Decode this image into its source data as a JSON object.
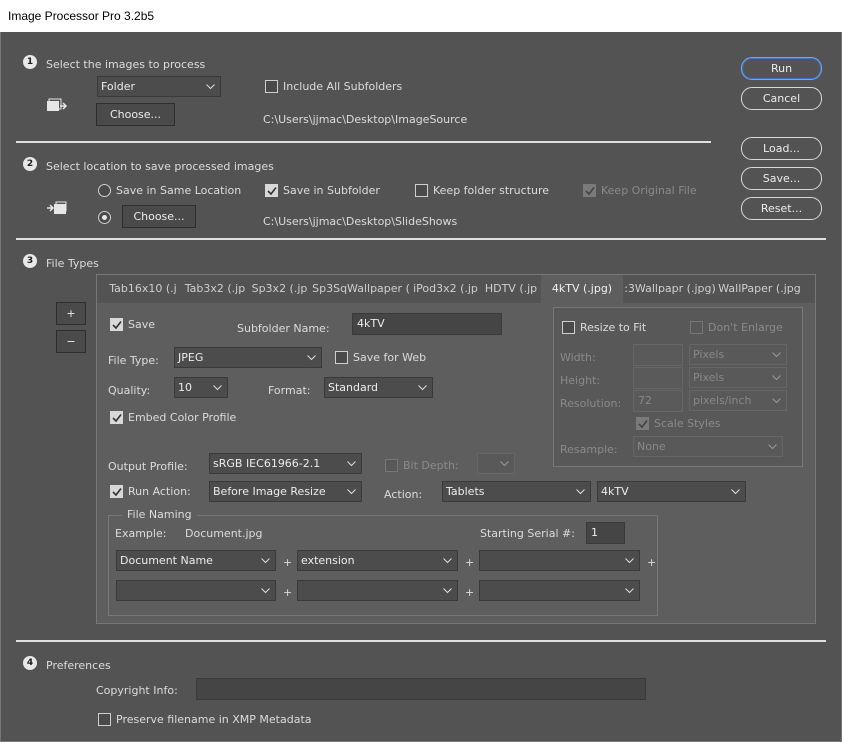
{
  "window": {
    "title": "Image Processor Pro 3.2b5"
  },
  "section1": {
    "num": "1",
    "heading": "Select the images to process",
    "source_type": "Folder",
    "include_subfolders": "Include All Subfolders",
    "choose_label": "Choose...",
    "path": "C:\\Users\\jjmac\\Desktop\\ImageSource"
  },
  "section2": {
    "num": "2",
    "heading": "Select location to save processed images",
    "same_location": "Save in Same Location",
    "save_subfolder": "Save in Subfolder",
    "keep_structure": "Keep folder structure",
    "keep_original": "Keep Original File",
    "choose_label": "Choose...",
    "path": "C:\\Users\\jjmac\\Desktop\\SlideShows"
  },
  "buttons": {
    "run": "Run",
    "cancel": "Cancel",
    "load": "Load...",
    "save": "Save...",
    "reset": "Reset..."
  },
  "section3": {
    "num": "3",
    "heading": "File Types",
    "plus": "+",
    "minus": "−",
    "tabs": [
      "Tab16x10 (.j",
      "Tab3x2 (.jp",
      "Sp3x2 (.jp",
      "Sp3SqWallpaper (",
      "iPod3x2 (.jp",
      "HDTV (.jp",
      "4kTV (.jpg)",
      ":3Wallpapr (.jpg)",
      "WallPaper (.jpg"
    ],
    "save": "Save",
    "subfolder_name_label": "Subfolder Name:",
    "subfolder_name": "4kTV",
    "file_type_label": "File Type:",
    "file_type": "JPEG",
    "save_for_web": "Save for Web",
    "quality_label": "Quality:",
    "quality": "10",
    "format_label": "Format:",
    "format": "Standard",
    "embed_profile": "Embed Color Profile",
    "output_profile_label": "Output Profile:",
    "output_profile": "sRGB IEC61966-2.1",
    "bit_depth": "Bit Depth:",
    "run_action": "Run Action:",
    "run_action_when": "Before Image Resize",
    "action_label": "Action:",
    "action_set": "Tablets",
    "action_name": "4kTV",
    "resize": {
      "resize_to_fit": "Resize to Fit",
      "dont_enlarge": "Don't Enlarge",
      "width_label": "Width:",
      "height_label": "Height:",
      "resolution_label": "Resolution:",
      "resolution": "72",
      "width_unit": "Pixels",
      "height_unit": "Pixels",
      "res_unit": "pixels/inch",
      "scale_styles": "Scale Styles",
      "resample_label": "Resample:",
      "resample": "None"
    },
    "naming": {
      "legend": "File Naming",
      "example_label": "Example:",
      "example": "Document.jpg",
      "serial_label": "Starting Serial #:",
      "serial": "1",
      "field1": "Document Name",
      "field2": "extension",
      "plus": "+"
    }
  },
  "section4": {
    "num": "4",
    "heading": "Preferences",
    "copyright_label": "Copyright Info:",
    "preserve": "Preserve filename in XMP Metadata"
  }
}
